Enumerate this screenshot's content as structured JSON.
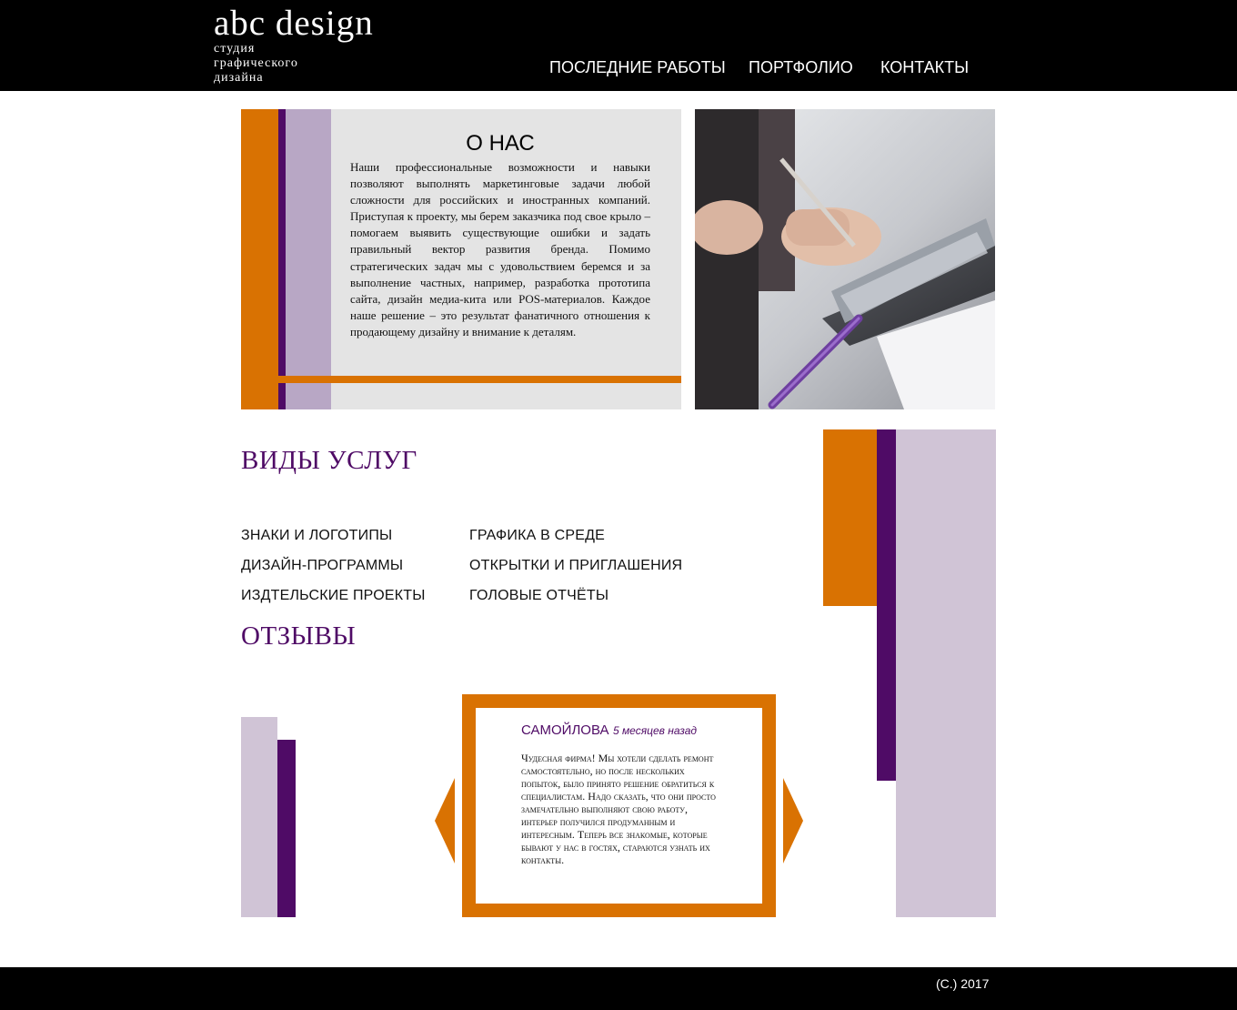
{
  "header": {
    "logo_title": "abc design",
    "logo_sub_1": "студия",
    "logo_sub_2": "графического",
    "logo_sub_3": "дизайна",
    "nav": [
      "ПОСЛЕДНИЕ РАБОТЫ",
      "ПОРТФОЛИО",
      "КОНТАКТЫ"
    ]
  },
  "about": {
    "title": "О НАС",
    "text": "Наши профессиональные возможности и навыки позволяют выполнять маркетинговые задачи любой сложности для российских и иностранных компаний. Приступая к проекту, мы берем заказчика под свое крыло – помогаем выявить существующие ошибки и задать правильный вектор развития бренда. Помимо стратегических задач мы с удовольствием беремся и за выполнение частных, например, разработка прототипа сайта, дизайн медиа-кита или POS-материалов. Каждое наше решение – это результат фанатичного отношения к продающему дизайну и внимание к деталям."
  },
  "services": {
    "title": "ВИДЫ УСЛУГ",
    "items": [
      "ЗНАКИ И ЛОГОТИПЫ",
      "ГРАФИКА В СРЕДЕ",
      "ДИЗАЙН-ПРОГРАММЫ",
      "ОТКРЫТКИ И ПРИГЛАШЕНИЯ",
      "ИЗДТЕЛЬСКИЕ ПРОЕКТЫ",
      "ГОЛОВЫЕ ОТЧЁТЫ"
    ]
  },
  "reviews": {
    "title": "ОТЗЫВЫ",
    "author": "САМОЙЛОВА",
    "time": "5 месяцев назад",
    "text": "Чудесная фирма! Мы хотели сделать ремонт самостоятельно, но после нескольких попыток, было принято решение обратиться к специалистам. Надо сказать, что они просто замечательно выполняют свою работу, интерьер получился продуманным и интересным. Теперь все знакомые, которые бывают у нас в гостях, стараются узнать их контакты."
  },
  "footer": {
    "copyright": "(C.) 2017"
  },
  "colors": {
    "orange": "#d97202",
    "purple": "#4f0b66",
    "lilac": "#d0c4d6",
    "header_bg": "#000000"
  },
  "icons": {
    "prev": "arrow-left-icon",
    "next": "arrow-right-icon"
  }
}
